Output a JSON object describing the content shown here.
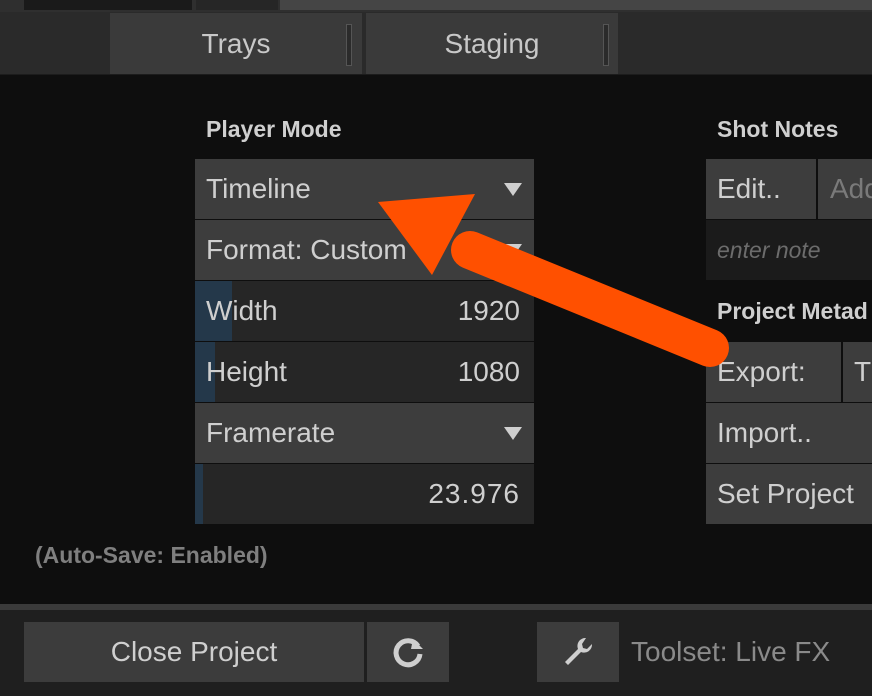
{
  "tabs": [
    {
      "label": "Trays"
    },
    {
      "label": "Staging"
    }
  ],
  "player_mode": {
    "title": "Player Mode",
    "mode_dropdown": "Timeline",
    "format_dropdown": "Format: Custom",
    "width": {
      "label": "Width",
      "value": "1920",
      "slider_fraction": 0.11
    },
    "height": {
      "label": "Height",
      "value": "1080",
      "slider_fraction": 0.06
    },
    "framerate": {
      "label": "Framerate",
      "value": "23.976",
      "slider_fraction": 0.02
    }
  },
  "autosave": "(Auto-Save: Enabled)",
  "shot_notes": {
    "title": "Shot Notes",
    "edit_button": "Edit..",
    "add_button": "Add",
    "note_placeholder": "enter note"
  },
  "project_meta": {
    "title": "Project Metad",
    "export_label": "Export:",
    "export_value": "T",
    "import_button": "Import..",
    "set_project_button": "Set Project"
  },
  "bottom": {
    "close_project": "Close Project",
    "toolset": "Toolset: Live FX"
  },
  "annotation": {
    "color": "#ff5000"
  },
  "icons": {
    "refresh": "refresh-icon",
    "wrench": "wrench-icon"
  }
}
